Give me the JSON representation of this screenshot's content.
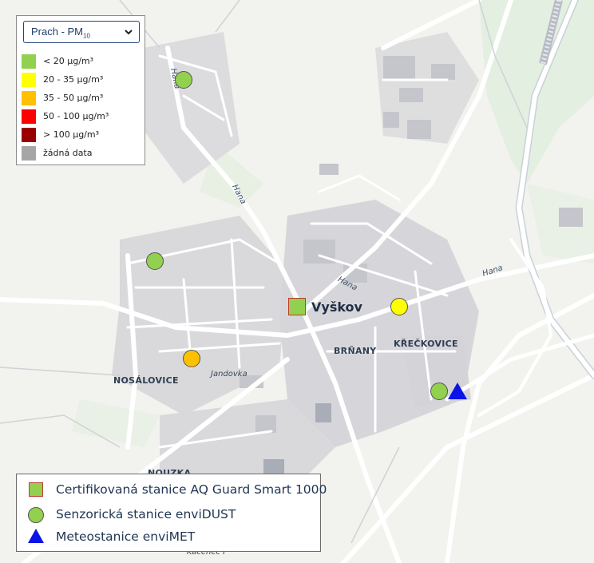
{
  "map": {
    "town_label": "Vyškov",
    "districts": [
      "NOSÁLOVICE",
      "BRŇANY",
      "KŘEČKOVICE",
      "NOUZKA"
    ],
    "streets": [
      "Hana",
      "Hana",
      "Hana",
      "Hana",
      "Jandovka",
      "Kácenec I"
    ]
  },
  "pm_legend": {
    "select": {
      "label": "Prach - PM",
      "subscript": "10",
      "options": [
        "Prach - PM10"
      ]
    },
    "items": [
      {
        "label": "< 20 µg/m³",
        "color": "#92d050"
      },
      {
        "label": "20 - 35 µg/m³",
        "color": "#ffff00"
      },
      {
        "label": "35 - 50 µg/m³",
        "color": "#ffc000"
      },
      {
        "label": "50 - 100 µg/m³",
        "color": "#ff0000"
      },
      {
        "label": "> 100 µg/m³",
        "color": "#990000"
      },
      {
        "label": "žádná data",
        "color": "#a6a6a6"
      }
    ]
  },
  "station_legend": {
    "items": [
      {
        "label": "Certifikovaná stanice AQ Guard Smart 1000",
        "symbol": "square"
      },
      {
        "label": "Senzorická stanice enviDUST",
        "symbol": "circle"
      },
      {
        "label": "Meteostanice enviMET",
        "symbol": "triangle"
      }
    ]
  },
  "stations": [
    {
      "type": "enviDUST",
      "level": "< 20 µg/m³",
      "color": "#92d050"
    },
    {
      "type": "enviDUST",
      "level": "< 20 µg/m³",
      "color": "#92d050"
    },
    {
      "type": "AQ Guard Smart 1000",
      "level": "< 20 µg/m³",
      "color": "#92d050"
    },
    {
      "type": "enviDUST",
      "level": "35 - 50 µg/m³",
      "color": "#ffc000"
    },
    {
      "type": "enviDUST",
      "level": "20 - 35 µg/m³",
      "color": "#ffff00"
    },
    {
      "type": "enviDUST",
      "level": "< 20 µg/m³",
      "color": "#92d050"
    },
    {
      "type": "enviMET",
      "level": "",
      "color": "#0a14e6"
    }
  ]
}
